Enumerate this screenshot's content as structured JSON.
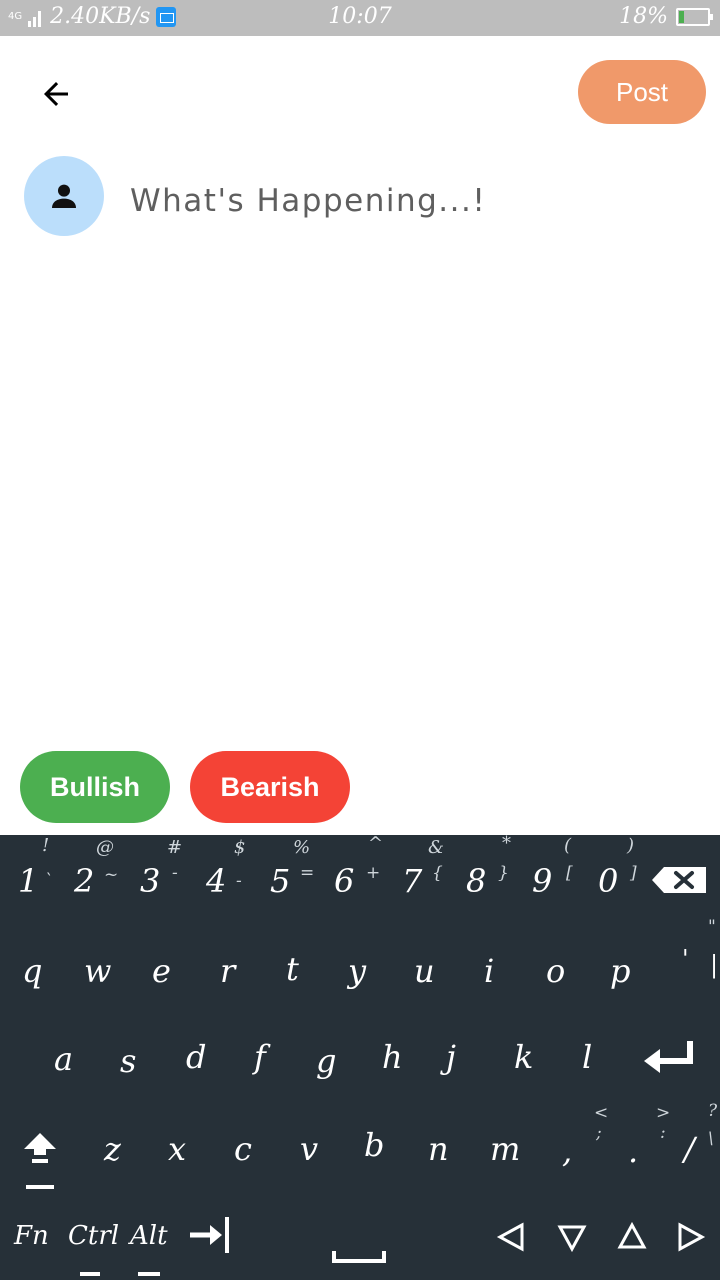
{
  "status_bar": {
    "network": "4G",
    "speed": "2.40KB/s",
    "time": "10:07",
    "battery": "18%",
    "battery_level": 0.18
  },
  "header": {
    "back_icon": "arrow-left-icon",
    "post_label": "Post"
  },
  "compose": {
    "avatar_icon": "person-icon",
    "placeholder": "What's Happening...!"
  },
  "sentiment": {
    "bullish_label": "Bullish",
    "bullish_color": "#4caf50",
    "bearish_label": "Bearish",
    "bearish_color": "#f44336"
  },
  "keyboard": {
    "row1_symbols": [
      "!",
      "@",
      "#",
      "$",
      "%",
      "^",
      "&",
      "*",
      "(",
      ")"
    ],
    "row1_digits": [
      "1",
      "2",
      "3",
      "4",
      "5",
      "6",
      "7",
      "8",
      "9",
      "0"
    ],
    "row1_sub": [
      "`",
      "~",
      "-",
      "-",
      "=",
      "+",
      "{",
      "}",
      "[",
      "]"
    ],
    "backspace_icon": "backspace-icon",
    "row2": [
      "q",
      "w",
      "e",
      "r",
      "t",
      "y",
      "u",
      "i",
      "o",
      "p"
    ],
    "row2_extra": [
      "'",
      "|",
      "\""
    ],
    "row3": [
      "a",
      "s",
      "d",
      "f",
      "g",
      "h",
      "j",
      "k",
      "l"
    ],
    "enter_icon": "enter-icon",
    "shift_icon": "shift-icon",
    "row4": [
      "z",
      "x",
      "c",
      "v",
      "b",
      "n",
      "m"
    ],
    "row4_punct": [
      ",",
      ";",
      "<",
      ".",
      ":",
      ">",
      "/",
      "\\",
      "?"
    ],
    "fn_label": "Fn",
    "ctrl_label": "Ctrl",
    "alt_label": "Alt",
    "tab_icon": "tab-icon",
    "space_icon": "spacebar-icon",
    "arrow_icons": [
      "left-arrow-icon",
      "down-arrow-icon",
      "up-arrow-icon",
      "right-arrow-icon"
    ]
  }
}
